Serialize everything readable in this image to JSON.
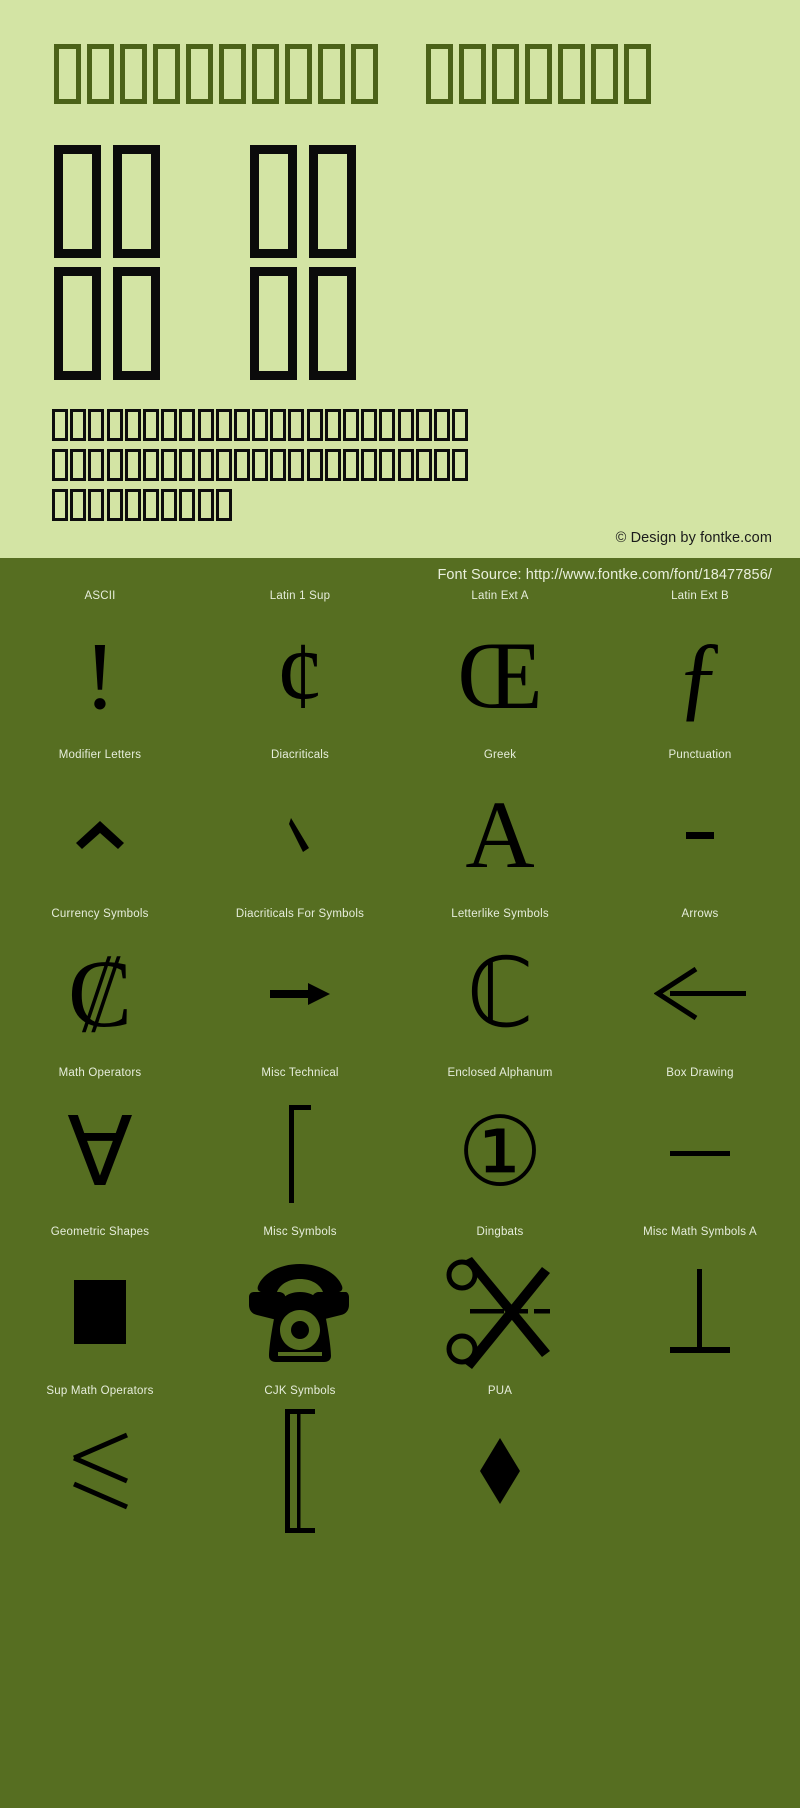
{
  "specimen": {
    "background_light": "#d3e4a4",
    "background_dark": "#566e21",
    "title_tofu_counts": [
      10,
      7
    ],
    "headline_rows": [
      [
        2,
        2
      ],
      [
        2,
        2
      ]
    ],
    "paragraph_tofu_counts": [
      23,
      23,
      10
    ],
    "credit": "© Design by fontke.com",
    "font_source": "Font Source: http://www.fontke.com/font/18477856/"
  },
  "blocks": [
    {
      "label": "ASCII",
      "glyph": "!",
      "icon": "exclamation-mark-glyph"
    },
    {
      "label": "Latin 1 Sup",
      "glyph": "¢",
      "icon": "cent-sign-glyph"
    },
    {
      "label": "Latin Ext A",
      "glyph": "Œ",
      "icon": "oe-ligature-glyph"
    },
    {
      "label": "Latin Ext B",
      "glyph": "ƒ",
      "icon": "florin-glyph"
    },
    {
      "label": "Modifier Letters",
      "glyph": "ˆ",
      "icon": "circumflex-glyph"
    },
    {
      "label": "Diacriticals",
      "glyph": "̀",
      "icon": "grave-accent-glyph"
    },
    {
      "label": "Greek",
      "glyph": "Α",
      "icon": "greek-capital-alpha-glyph"
    },
    {
      "label": "Punctuation",
      "glyph": "‐",
      "icon": "hyphen-glyph"
    },
    {
      "label": "Currency Symbols",
      "glyph": "₡",
      "icon": "colon-currency-sign-glyph"
    },
    {
      "label": "Diacriticals For Symbols",
      "glyph": "→",
      "icon": "rightwards-arrow-glyph"
    },
    {
      "label": "Letterlike Symbols",
      "glyph": "ℂ",
      "icon": "double-struck-c-glyph"
    },
    {
      "label": "Arrows",
      "glyph": "←",
      "icon": "leftwards-arrow-glyph"
    },
    {
      "label": "Math Operators",
      "glyph": "∀",
      "icon": "for-all-glyph"
    },
    {
      "label": "Misc Technical",
      "glyph": "⌠",
      "icon": "integral-top-glyph"
    },
    {
      "label": "Enclosed Alphanum",
      "glyph": "①",
      "icon": "circled-one-glyph"
    },
    {
      "label": "Box Drawing",
      "glyph": "─",
      "icon": "box-drawing-light-horizontal-glyph"
    },
    {
      "label": "Geometric Shapes",
      "glyph": "■",
      "icon": "black-square-glyph"
    },
    {
      "label": "Misc Symbols",
      "glyph": "☎",
      "icon": "telephone-glyph"
    },
    {
      "label": "Dingbats",
      "glyph": "✂",
      "icon": "scissors-glyph"
    },
    {
      "label": "Misc Math Symbols A",
      "glyph": "⟂",
      "icon": "perpendicular-glyph"
    },
    {
      "label": "Sup Math Operators",
      "glyph": "⩽",
      "icon": "less-than-or-slanted-equal-glyph"
    },
    {
      "label": "CJK Symbols",
      "glyph": "〚",
      "icon": "left-white-square-bracket-glyph"
    },
    {
      "label": "PUA",
      "glyph": "◆",
      "icon": "black-diamond-glyph"
    }
  ]
}
